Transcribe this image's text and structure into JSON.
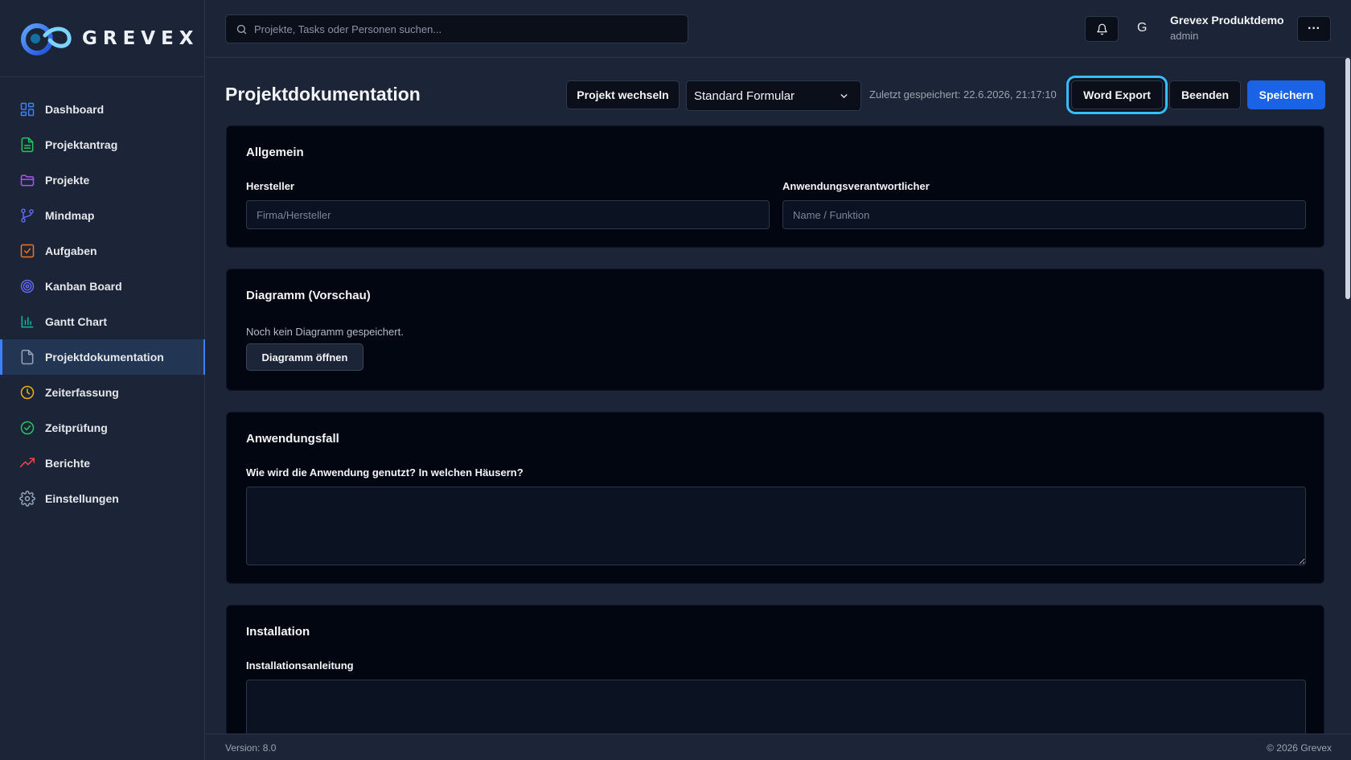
{
  "brand": {
    "name": "GREVEX"
  },
  "sidebar": {
    "items": [
      {
        "label": "Dashboard",
        "icon": "dashboard-icon",
        "color": "#3b82f6"
      },
      {
        "label": "Projektantrag",
        "icon": "document-icon",
        "color": "#22c55e"
      },
      {
        "label": "Projekte",
        "icon": "folder-icon",
        "color": "#a855f7"
      },
      {
        "label": "Mindmap",
        "icon": "mindmap-icon",
        "color": "#6366f1"
      },
      {
        "label": "Aufgaben",
        "icon": "task-icon",
        "color": "#f97316"
      },
      {
        "label": "Kanban Board",
        "icon": "target-icon",
        "color": "#6366f1"
      },
      {
        "label": "Gantt Chart",
        "icon": "bar-chart-icon",
        "color": "#14b8a6"
      },
      {
        "label": "Projektdokumentation",
        "icon": "file-icon",
        "color": "#94a3b8"
      },
      {
        "label": "Zeiterfassung",
        "icon": "clock-icon",
        "color": "#eab308"
      },
      {
        "label": "Zeitprüfung",
        "icon": "check-circle-icon",
        "color": "#22c55e"
      },
      {
        "label": "Berichte",
        "icon": "trend-icon",
        "color": "#ef4444"
      },
      {
        "label": "Einstellungen",
        "icon": "gear-icon",
        "color": "#94a3b8"
      }
    ],
    "active_index": 7
  },
  "topbar": {
    "search_placeholder": "Projekte, Tasks oder Personen suchen...",
    "avatar_initial": "G",
    "user_name": "Grevex Produktdemo",
    "user_role": "admin",
    "more_label": "···"
  },
  "page": {
    "title": "Projektdokumentation",
    "switch_project": "Projekt wechseln",
    "form_select": "Standard Formular",
    "last_saved": "Zuletzt gespeichert: 22.6.2026, 21:17:10",
    "word_export": "Word Export",
    "end": "Beenden",
    "save": "Speichern"
  },
  "sections": {
    "general": {
      "title": "Allgemein",
      "manufacturer_label": "Hersteller",
      "manufacturer_placeholder": "Firma/Hersteller",
      "owner_label": "Anwendungsverantwortlicher",
      "owner_placeholder": "Name / Funktion"
    },
    "diagram": {
      "title": "Diagramm (Vorschau)",
      "empty_text": "Noch kein Diagramm gespeichert.",
      "open_button": "Diagramm öffnen"
    },
    "usecase": {
      "title": "Anwendungsfall",
      "question_label": "Wie wird die Anwendung genutzt? In welchen Häusern?"
    },
    "installation": {
      "title": "Installation",
      "guide_label": "Installationsanleitung"
    }
  },
  "footer": {
    "version": "Version: 8.0",
    "copyright": "© 2026 Grevex"
  },
  "colors": {
    "accent": "#1a63e6",
    "focus_ring": "#38bdf8",
    "sidebar_bg": "#1b2537",
    "card_bg": "#020611"
  }
}
